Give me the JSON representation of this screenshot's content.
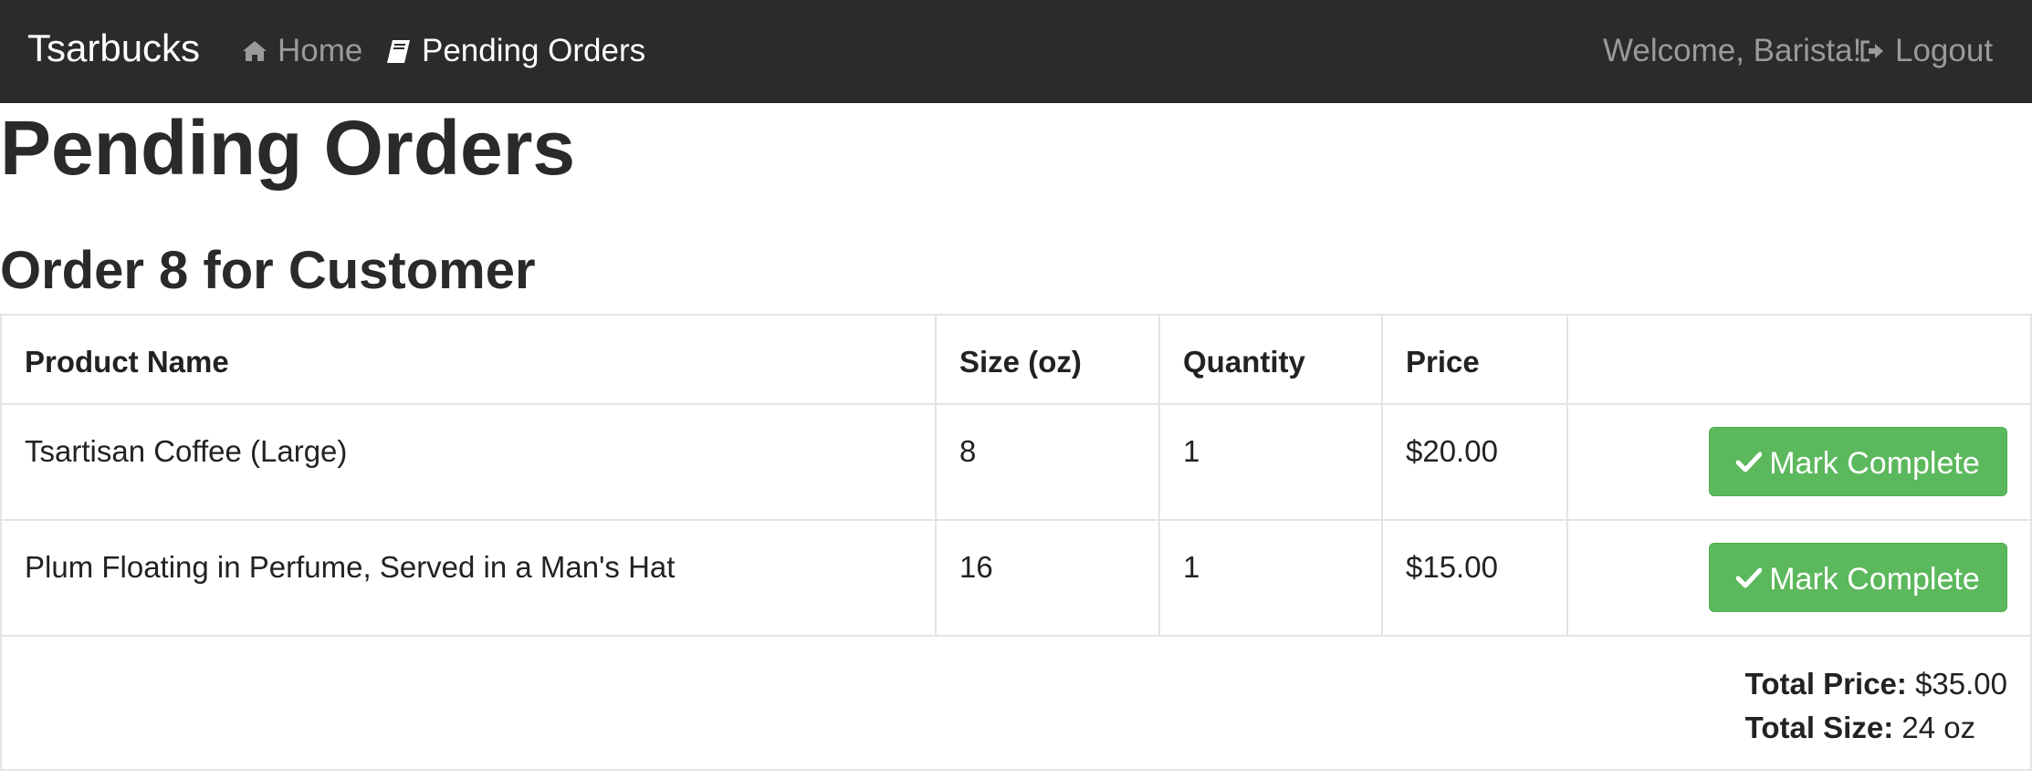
{
  "navbar": {
    "brand": "Tsarbucks",
    "links": [
      {
        "icon": "home-icon",
        "label": "Home"
      },
      {
        "icon": "book-icon",
        "label": "Pending Orders"
      }
    ],
    "welcome": "Welcome, Barista!",
    "logout": {
      "icon": "logout-icon",
      "label": "Logout"
    }
  },
  "page": {
    "title": "Pending Orders"
  },
  "order": {
    "title": "Order 8 for Customer",
    "columns": [
      "Product Name",
      "Size (oz)",
      "Quantity",
      "Price",
      ""
    ],
    "rows": [
      {
        "product": "Tsartisan Coffee (Large)",
        "size": "8",
        "quantity": "1",
        "price": "$20.00",
        "action": "Mark Complete"
      },
      {
        "product": "Plum Floating in Perfume, Served in a Man's Hat",
        "size": "16",
        "quantity": "1",
        "price": "$15.00",
        "action": "Mark Complete"
      }
    ],
    "totals": {
      "price_label": "Total Price:",
      "price_value": "$35.00",
      "size_label": "Total Size:",
      "size_value": "24 oz"
    }
  },
  "colors": {
    "navbar_bg": "#2b2b2d",
    "nav_muted": "#9a9a9a",
    "success": "#5cb85c"
  }
}
